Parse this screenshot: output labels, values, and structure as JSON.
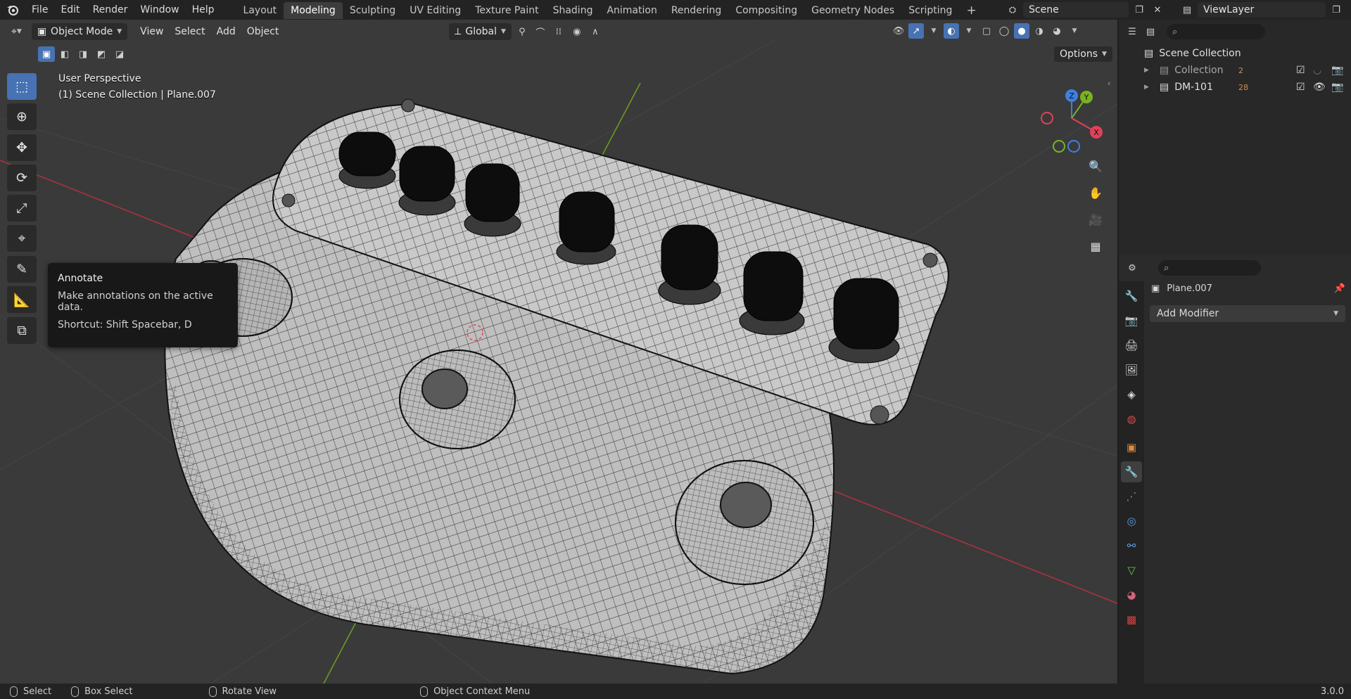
{
  "app": {
    "logo": "blender-logo-icon",
    "menus": [
      "File",
      "Edit",
      "Render",
      "Window",
      "Help"
    ],
    "workspaces": [
      "Layout",
      "Modeling",
      "Sculpting",
      "UV Editing",
      "Texture Paint",
      "Shading",
      "Animation",
      "Rendering",
      "Compositing",
      "Geometry Nodes",
      "Scripting"
    ],
    "active_workspace": "Modeling",
    "add_workspace": "+",
    "scene": "Scene",
    "view_layer": "ViewLayer"
  },
  "viewport_header": {
    "mode": "Object Mode",
    "menus": [
      "View",
      "Select",
      "Add",
      "Object"
    ],
    "orientation": "Global",
    "options": "Options"
  },
  "overlay": {
    "line1": "User Perspective",
    "line2": "(1) Scene Collection | Plane.007"
  },
  "gizmo": {
    "z": "Z",
    "y": "Y",
    "x": "X"
  },
  "tooltip": {
    "title": "Annotate",
    "description": "Make annotations on the active data.",
    "shortcut": "Shortcut: Shift Spacebar, D"
  },
  "outliner": {
    "root": "Scene Collection",
    "items": [
      {
        "label": "Collection",
        "badge": "2"
      },
      {
        "label": "DM-101",
        "badge": "28"
      }
    ]
  },
  "properties": {
    "object_name": "Plane.007",
    "add_modifier": "Add Modifier"
  },
  "statusbar": {
    "select": "Select",
    "box_select": "Box Select",
    "rotate_view": "Rotate View",
    "context_menu": "Object Context Menu",
    "version": "3.0.0"
  },
  "colors": {
    "accent": "#4772b3",
    "axis_x": "#e0415a",
    "axis_y": "#78b41e",
    "axis_z": "#3f7fe0",
    "viewport_bg": "#3a3a3a"
  }
}
